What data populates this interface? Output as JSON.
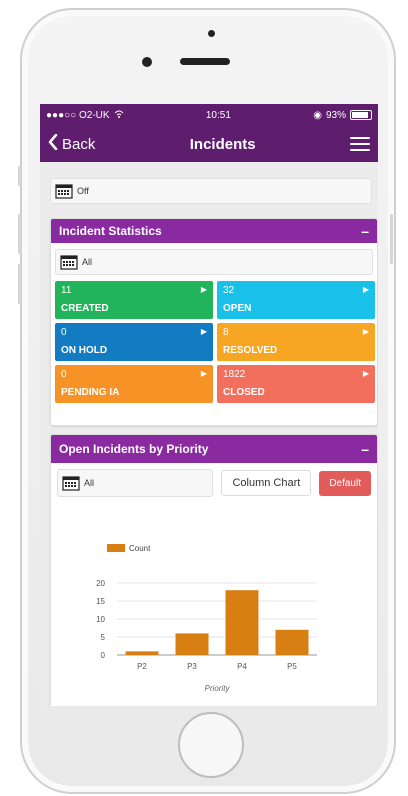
{
  "status": {
    "carrier": "●●●○○ O2-UK",
    "time": "10:51",
    "battery": "93%"
  },
  "nav": {
    "back": "Back",
    "title": "Incidents"
  },
  "top_filter": {
    "value": "Off"
  },
  "stats": {
    "title": "Incident Statistics",
    "filter": "All",
    "tiles": [
      {
        "count": "11",
        "label": "CREATED",
        "color": "#22b45a"
      },
      {
        "count": "32",
        "label": "OPEN",
        "color": "#19c1ea"
      },
      {
        "count": "0",
        "label": "ON HOLD",
        "color": "#137bc2"
      },
      {
        "count": "8",
        "label": "RESOLVED",
        "color": "#f6a623"
      },
      {
        "count": "0",
        "label": "PENDING IA",
        "color": "#f79226"
      },
      {
        "count": "1822",
        "label": "CLOSED",
        "color": "#f26f5e"
      }
    ]
  },
  "priority": {
    "title": "Open Incidents by Priority",
    "filter": "All",
    "chart_type_select": "Column Chart",
    "default_btn": "Default"
  },
  "chart_data": {
    "type": "bar",
    "categories": [
      "P2",
      "P3",
      "P4",
      "P5"
    ],
    "series": [
      {
        "name": "Count",
        "values": [
          1,
          6,
          18,
          7
        ]
      }
    ],
    "xlabel": "Priority",
    "ylabel": "",
    "ylim": [
      0,
      20
    ],
    "yticks": [
      0,
      5,
      10,
      15,
      20
    ],
    "legend": "top-left",
    "bar_color": "#d77f12"
  }
}
